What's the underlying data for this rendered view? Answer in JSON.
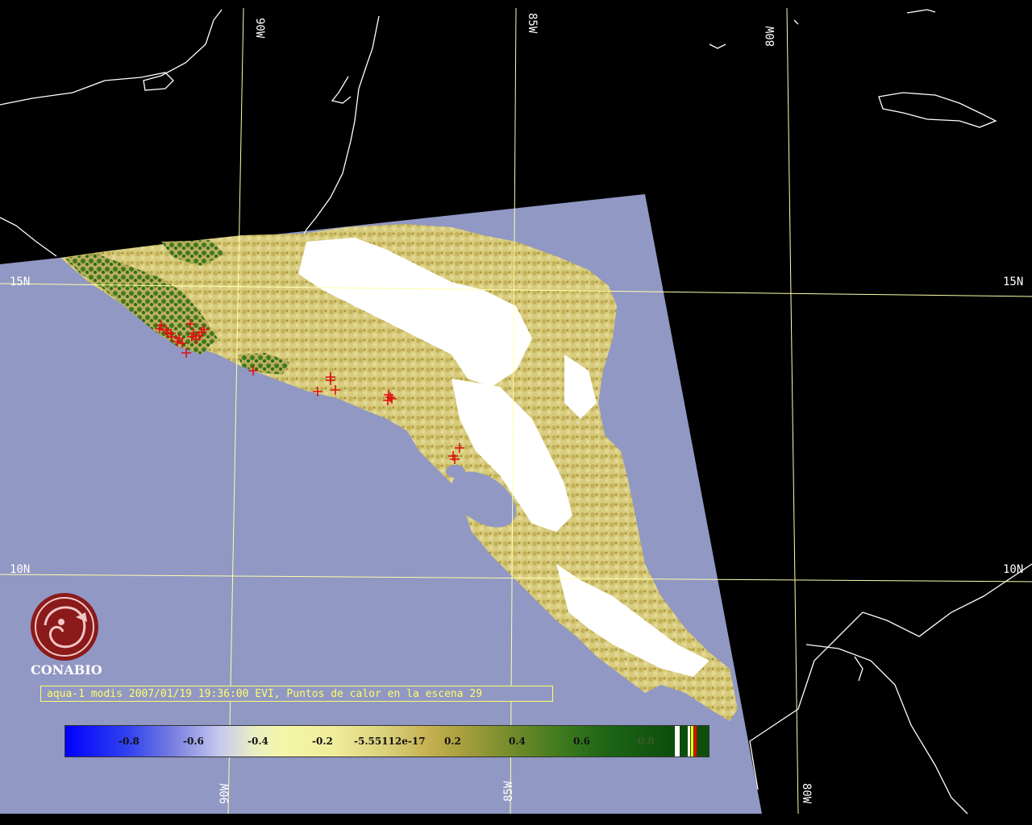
{
  "colors": {
    "ocean_scene": "#9198c4",
    "background": "#000000",
    "land_outline": "#ffffff",
    "graticule": "#ffffaa",
    "hotspot": "#dd1111",
    "caption_text": "#ffff66",
    "logo": "#8b1a1a"
  },
  "graticule": {
    "top_labels": [
      "90W",
      "85W",
      "80W"
    ],
    "bottom_labels": [
      "90W",
      "85W",
      "80W"
    ],
    "left_labels": [
      "15N",
      "10N"
    ],
    "right_labels": [
      "15N",
      "10N"
    ]
  },
  "logo": {
    "name": "CONABIO",
    "icon": "conabio-logo-icon"
  },
  "caption": "aqua-1 modis 2007/01/19 19:36:00 EVI, Puntos de calor en la escena 29",
  "colorbar": {
    "ticks": [
      "-0.8",
      "-0.6",
      "-0.4",
      "-0.2",
      "-5.55112e-17",
      "0.2",
      "0.4",
      "0.6",
      "0.8"
    ],
    "end_swatches": [
      "#ffffff",
      "#ffffff",
      "#ffff00",
      "#ff0000"
    ]
  },
  "hotspot_count": 29
}
